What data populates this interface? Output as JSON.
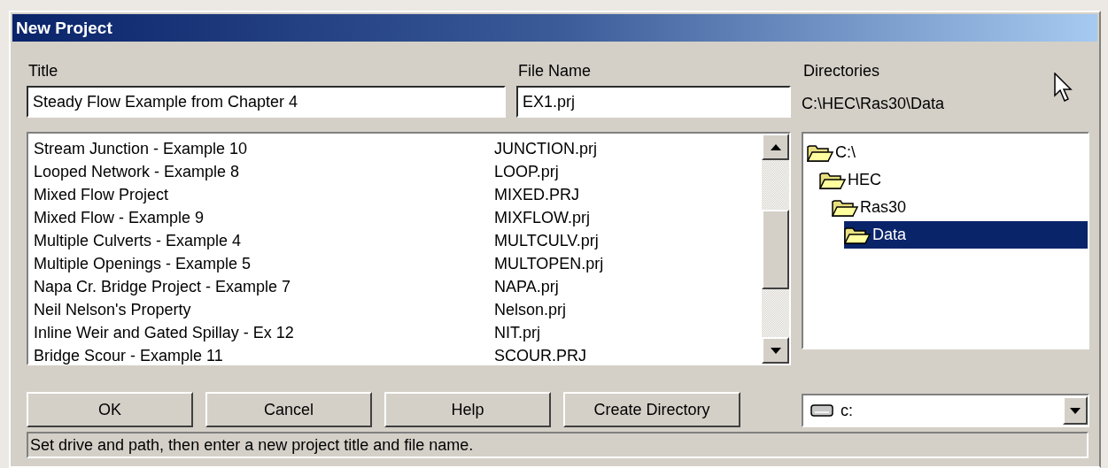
{
  "window": {
    "title": "New Project"
  },
  "title_field": {
    "label": "Title",
    "value": "Steady Flow Example from Chapter 4"
  },
  "file_name_field": {
    "label": "File Name",
    "value": "EX1.prj"
  },
  "directories": {
    "label": "Directories",
    "path": "C:\\HEC\\Ras30\\Data",
    "tree": [
      {
        "name": "C:\\",
        "selected": false,
        "children": [
          {
            "name": "HEC",
            "selected": false,
            "children": [
              {
                "name": "Ras30",
                "selected": false,
                "children": [
                  {
                    "name": "Data",
                    "selected": true
                  }
                ]
              }
            ]
          }
        ]
      }
    ]
  },
  "projects": [
    {
      "title": "Stream Junction - Example 10",
      "file": "JUNCTION.prj"
    },
    {
      "title": "Looped Network - Example 8",
      "file": "LOOP.prj"
    },
    {
      "title": "Mixed Flow Project",
      "file": "MIXED.PRJ"
    },
    {
      "title": "Mixed Flow - Example 9",
      "file": "MIXFLOW.prj"
    },
    {
      "title": "Multiple Culverts - Example 4",
      "file": "MULTCULV.prj"
    },
    {
      "title": "Multiple Openings - Example 5",
      "file": "MULTOPEN.prj"
    },
    {
      "title": "Napa Cr. Bridge Project - Example 7",
      "file": "NAPA.prj"
    },
    {
      "title": "Neil Nelson's Property",
      "file": "Nelson.prj"
    },
    {
      "title": "Inline Weir and Gated Spillay - Ex 12",
      "file": "NIT.prj"
    },
    {
      "title": "Bridge Scour - Example 11",
      "file": "SCOUR.PRJ"
    }
  ],
  "buttons": [
    "OK",
    "Cancel",
    "Help",
    "Create Directory"
  ],
  "drive": {
    "value": "c:"
  },
  "status_bar": "Set drive and path, then enter a new project title and file name."
}
